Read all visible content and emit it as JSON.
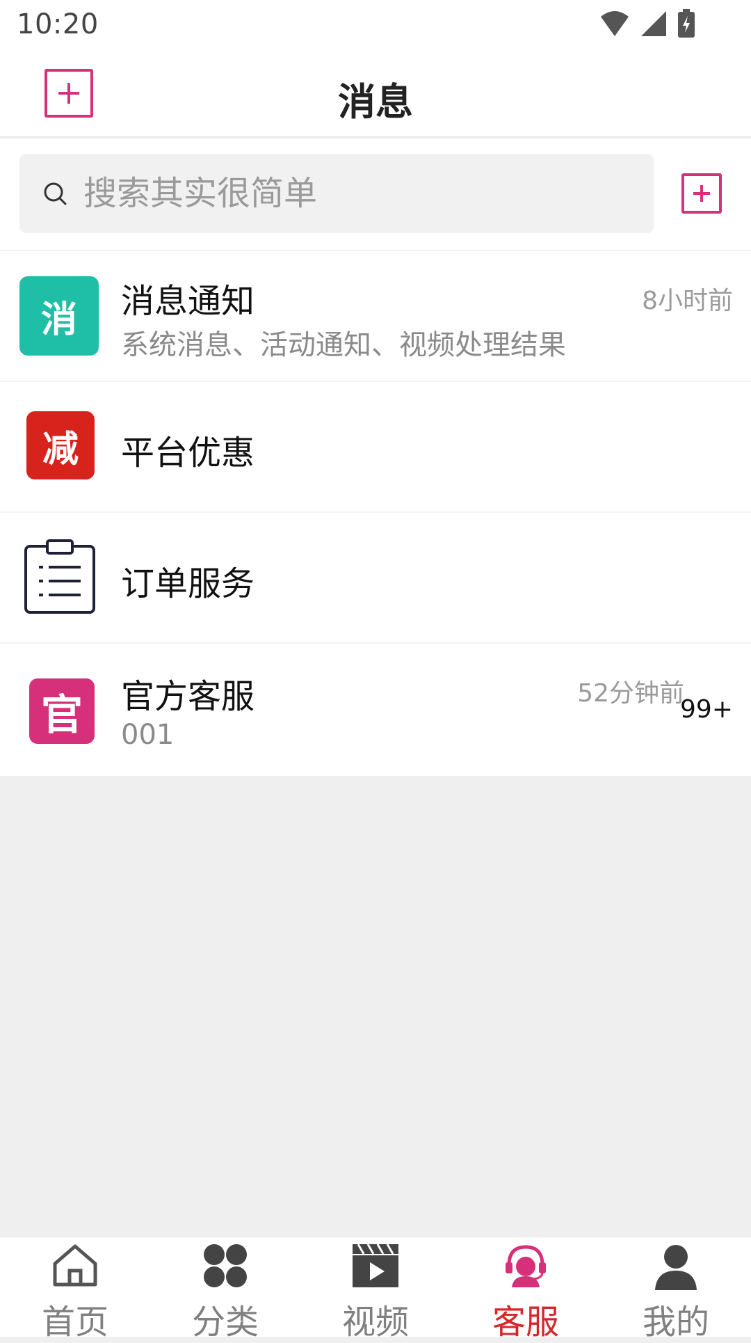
{
  "status_bar": {
    "time": "10:20"
  },
  "header": {
    "title": "消息"
  },
  "search": {
    "placeholder": "搜索其实很简单"
  },
  "messages": [
    {
      "icon_text": "消",
      "icon_color": "#1fbea6",
      "title": "消息通知",
      "subtitle": "系统消息、活动通知、视频处理结果",
      "time": "8小时前"
    },
    {
      "icon_text": "减",
      "icon_color": "#d8231d",
      "title": "平台优惠"
    },
    {
      "icon": "clipboard-icon",
      "title": "订单服务"
    },
    {
      "icon_text": "官",
      "icon_color": "#d7307b",
      "title": "官方客服",
      "subtitle": "001",
      "time": "52分钟前",
      "badge": "99+"
    }
  ],
  "tabs": [
    {
      "label": "首页",
      "icon": "home-icon"
    },
    {
      "label": "分类",
      "icon": "category-icon"
    },
    {
      "label": "视频",
      "icon": "video-icon"
    },
    {
      "label": "客服",
      "icon": "customer-service-icon",
      "active": true
    },
    {
      "label": "我的",
      "icon": "user-icon"
    }
  ],
  "colors": {
    "accent": "#d6307a",
    "active_tab": "#d7262a"
  }
}
